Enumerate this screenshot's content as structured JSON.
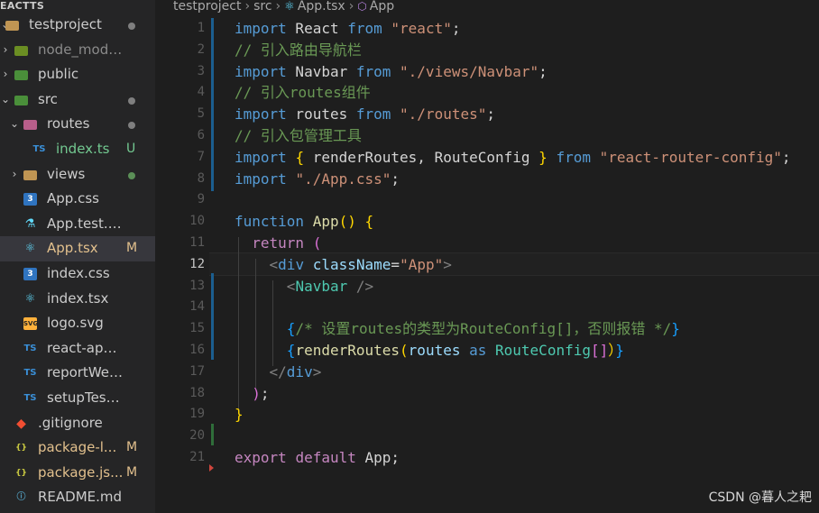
{
  "sidebar": {
    "header": "EACTTS",
    "items": [
      {
        "label": "testproject",
        "type": "folder-open",
        "status": "dot"
      },
      {
        "label": "node_modules",
        "type": "folder",
        "status": ""
      },
      {
        "label": "public",
        "type": "folder",
        "status": ""
      },
      {
        "label": "src",
        "type": "folder-open",
        "status": "dot"
      },
      {
        "label": "routes",
        "type": "folder-open",
        "status": "dot"
      },
      {
        "label": "index.ts",
        "type": "ts",
        "status": "U"
      },
      {
        "label": "views",
        "type": "folder",
        "status": "dot"
      },
      {
        "label": "App.css",
        "type": "css",
        "status": ""
      },
      {
        "label": "App.test.tsx",
        "type": "test",
        "status": ""
      },
      {
        "label": "App.tsx",
        "type": "react",
        "status": "M"
      },
      {
        "label": "index.css",
        "type": "css",
        "status": ""
      },
      {
        "label": "index.tsx",
        "type": "react",
        "status": ""
      },
      {
        "label": "logo.svg",
        "type": "svg",
        "status": ""
      },
      {
        "label": "react-app-env....",
        "type": "ts",
        "status": ""
      },
      {
        "label": "reportWebVital...",
        "type": "ts",
        "status": ""
      },
      {
        "label": "setupTests.ts",
        "type": "ts",
        "status": ""
      },
      {
        "label": ".gitignore",
        "type": "git",
        "status": ""
      },
      {
        "label": "package-l...",
        "type": "json",
        "status": "M"
      },
      {
        "label": "package.js...",
        "type": "json",
        "status": "M"
      },
      {
        "label": "README.md",
        "type": "md",
        "status": ""
      }
    ]
  },
  "breadcrumb": {
    "parts": [
      "testproject",
      "src",
      "App.tsx",
      "App"
    ]
  },
  "editor": {
    "current_line": 12,
    "line_numbers": [
      "1",
      "2",
      "3",
      "4",
      "5",
      "6",
      "7",
      "8",
      "9",
      "10",
      "11",
      "12",
      "13",
      "14",
      "15",
      "16",
      "17",
      "18",
      "19",
      "20",
      "21"
    ],
    "lines": [
      {
        "indent": "",
        "tokens": [
          [
            "kw",
            "import"
          ],
          [
            "txt",
            " React "
          ],
          [
            "kw",
            "from"
          ],
          [
            "txt",
            " "
          ],
          [
            "str",
            "\"react\""
          ],
          [
            "txt",
            ";"
          ]
        ]
      },
      {
        "indent": "",
        "tokens": [
          [
            "cm",
            "// 引入路由导航栏"
          ]
        ]
      },
      {
        "indent": "",
        "tokens": [
          [
            "kw",
            "import"
          ],
          [
            "txt",
            " Navbar "
          ],
          [
            "kw",
            "from"
          ],
          [
            "txt",
            " "
          ],
          [
            "str",
            "\"./views/Navbar\""
          ],
          [
            "txt",
            ";"
          ]
        ]
      },
      {
        "indent": "",
        "tokens": [
          [
            "cm",
            "// 引入routes组件"
          ]
        ]
      },
      {
        "indent": "",
        "tokens": [
          [
            "kw",
            "import"
          ],
          [
            "txt",
            " routes "
          ],
          [
            "kw",
            "from"
          ],
          [
            "txt",
            " "
          ],
          [
            "str",
            "\"./routes\""
          ],
          [
            "txt",
            ";"
          ]
        ]
      },
      {
        "indent": "",
        "tokens": [
          [
            "cm",
            "// 引入包管理工具"
          ]
        ]
      },
      {
        "indent": "",
        "tokens": [
          [
            "kw",
            "import"
          ],
          [
            "txt",
            " "
          ],
          [
            "br",
            "{"
          ],
          [
            "txt",
            " renderRoutes, RouteConfig "
          ],
          [
            "br",
            "}"
          ],
          [
            "txt",
            " "
          ],
          [
            "kw",
            "from"
          ],
          [
            "txt",
            " "
          ],
          [
            "str",
            "\"react-router-config\""
          ],
          [
            "txt",
            ";"
          ]
        ]
      },
      {
        "indent": "",
        "tokens": [
          [
            "kw",
            "import"
          ],
          [
            "txt",
            " "
          ],
          [
            "str",
            "\"./App.css\""
          ],
          [
            "txt",
            ";"
          ]
        ]
      },
      {
        "indent": "",
        "tokens": []
      },
      {
        "indent": "",
        "tokens": [
          [
            "kw",
            "function"
          ],
          [
            "txt",
            " "
          ],
          [
            "fn",
            "App"
          ],
          [
            "br",
            "()"
          ],
          [
            "txt",
            " "
          ],
          [
            "br",
            "{"
          ]
        ]
      },
      {
        "indent": "  ",
        "tokens": [
          [
            "ctl",
            "return"
          ],
          [
            "txt",
            " "
          ],
          [
            "br2",
            "("
          ]
        ]
      },
      {
        "indent": "    ",
        "tokens": [
          [
            "gray",
            "<"
          ],
          [
            "tag",
            "div"
          ],
          [
            "txt",
            " "
          ],
          [
            "attr",
            "className"
          ],
          [
            "txt",
            "="
          ],
          [
            "str",
            "\"App\""
          ],
          [
            "gray",
            ">"
          ]
        ]
      },
      {
        "indent": "      ",
        "tokens": [
          [
            "gray",
            "<"
          ],
          [
            "comp",
            "Navbar"
          ],
          [
            "txt",
            " "
          ],
          [
            "gray",
            "/>"
          ]
        ]
      },
      {
        "indent": "",
        "tokens": []
      },
      {
        "indent": "      ",
        "tokens": [
          [
            "br3",
            "{"
          ],
          [
            "cm",
            "/* 设置routes的类型为RouteConfig[]，否则报错 */"
          ],
          [
            "br3",
            "}"
          ]
        ]
      },
      {
        "indent": "      ",
        "tokens": [
          [
            "br3",
            "{"
          ],
          [
            "fn",
            "renderRoutes"
          ],
          [
            "br",
            "("
          ],
          [
            "var",
            "routes"
          ],
          [
            "txt",
            " "
          ],
          [
            "kw",
            "as"
          ],
          [
            "txt",
            " "
          ],
          [
            "type",
            "RouteConfig"
          ],
          [
            "br2",
            "[]"
          ],
          [
            "br",
            "）"
          ],
          [
            "br3",
            "}"
          ]
        ]
      },
      {
        "indent": "    ",
        "tokens": [
          [
            "gray",
            "</"
          ],
          [
            "tag",
            "div"
          ],
          [
            "gray",
            ">"
          ]
        ]
      },
      {
        "indent": "  ",
        "tokens": [
          [
            "br2",
            ")"
          ],
          [
            "txt",
            ";"
          ]
        ]
      },
      {
        "indent": "",
        "tokens": [
          [
            "br",
            "}"
          ]
        ]
      },
      {
        "indent": "",
        "tokens": []
      },
      {
        "indent": "",
        "tokens": [
          [
            "ctl",
            "export"
          ],
          [
            "txt",
            " "
          ],
          [
            "ctl",
            "default"
          ],
          [
            "txt",
            " App;"
          ]
        ]
      }
    ]
  },
  "watermark": "CSDN @暮人之耙"
}
